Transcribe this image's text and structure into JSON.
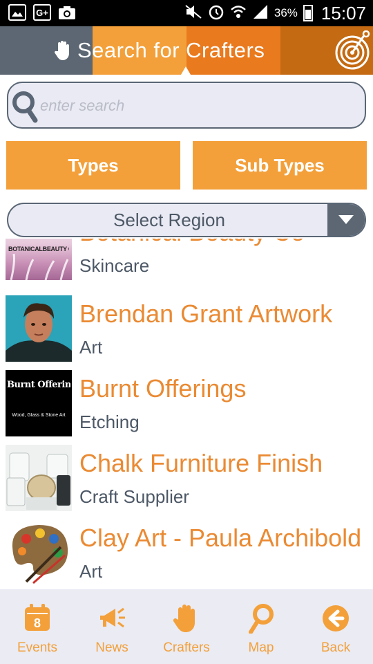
{
  "status_bar": {
    "icons_left": [
      "image-icon",
      "google-plus-icon",
      "camera-icon"
    ],
    "google_plus_text": "G+",
    "battery_percent": "36%",
    "time": "15:07"
  },
  "header": {
    "title": "Search for Crafters",
    "colors": [
      "#5c6773",
      "#f3a03a",
      "#ea7a1e",
      "#c46a12"
    ]
  },
  "search": {
    "placeholder": "enter search",
    "value": ""
  },
  "filters": {
    "types_label": "Types",
    "subtypes_label": "Sub Types"
  },
  "region": {
    "label": "Select Region"
  },
  "crafters": [
    {
      "name": "Botanical Beauty Co",
      "type": "Skincare",
      "thumb_text": "BOTANICALBEAUTY CO."
    },
    {
      "name": "Brendan Grant Artwork",
      "type": "Art"
    },
    {
      "name": "Burnt Offerings",
      "type": "Etching",
      "thumb_line1": "Burnt Offerings",
      "thumb_line2": "Wood, Glass & Stone Art"
    },
    {
      "name": "Chalk Furniture Finish",
      "type": "Craft Supplier"
    },
    {
      "name": "Clay Art - Paula Archibold",
      "type": "Art"
    }
  ],
  "nav": {
    "events": "Events",
    "events_badge": "8",
    "news": "News",
    "crafters": "Crafters",
    "map": "Map",
    "back": "Back"
  },
  "accent": "#f3a03a",
  "text_dark": "#4d5866"
}
